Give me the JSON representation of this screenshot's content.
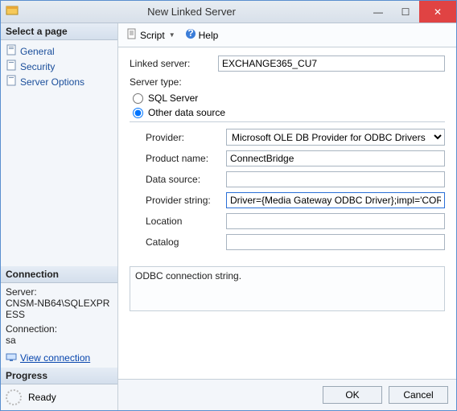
{
  "window": {
    "title": "New Linked Server"
  },
  "sidebar": {
    "select_head": "Select a page",
    "items": [
      {
        "label": "General"
      },
      {
        "label": "Security"
      },
      {
        "label": "Server Options"
      }
    ],
    "connection_head": "Connection",
    "server_label": "Server:",
    "server_value": "CNSM-NB64\\SQLEXPRESS",
    "conn_label": "Connection:",
    "conn_value": "sa",
    "view_conn": "View connection ",
    "progress_head": "Progress",
    "ready": "Ready"
  },
  "toolbar": {
    "script": "Script",
    "help": "Help"
  },
  "form": {
    "linked_server_label": "Linked server:",
    "linked_server_value": "EXCHANGE365_CU7",
    "server_type_label": "Server type:",
    "radio_sql": "SQL Server",
    "radio_other": "Other data source",
    "provider_label": "Provider:",
    "provider_value": "Microsoft OLE DB Provider for ODBC Drivers",
    "product_label": "Product name:",
    "product_value": "ConnectBridge",
    "datasource_label": "Data source:",
    "datasource_value": "",
    "provstr_label": "Provider string:",
    "provstr_value": "Driver={Media Gateway ODBC Driver};impl='CORE",
    "location_label": "Location",
    "location_value": "",
    "catalog_label": "Catalog",
    "catalog_value": ""
  },
  "hint": "ODBC connection string.",
  "buttons": {
    "ok": "OK",
    "cancel": "Cancel"
  }
}
